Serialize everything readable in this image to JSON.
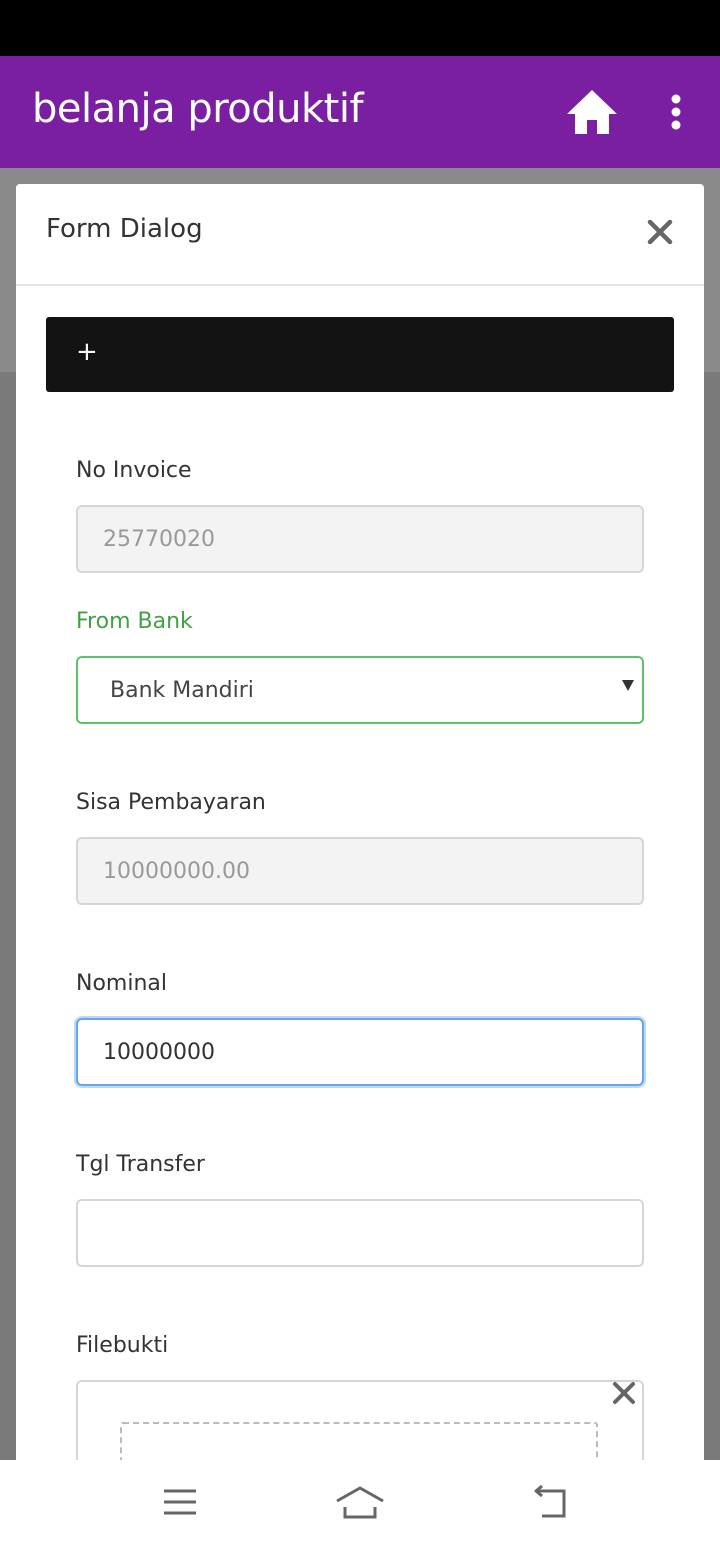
{
  "app": {
    "title": "belanja produktif",
    "accent_color": "#7b1fa2",
    "icons": [
      "home-icon",
      "more-vert-icon"
    ]
  },
  "dialog": {
    "title": "Form Dialog",
    "close_icon": "close-icon",
    "add_bar_label": "+"
  },
  "form": {
    "no_invoice": {
      "label": "No Invoice",
      "value": "25770020"
    },
    "from_bank": {
      "label": "From Bank",
      "selected": "Bank Mandiri"
    },
    "sisa_pembayaran": {
      "label": "Sisa Pembayaran",
      "value": "10000000.00"
    },
    "nominal": {
      "label": "Nominal",
      "value": "10000000"
    },
    "tgl_transfer": {
      "label": "Tgl Transfer",
      "value": ""
    },
    "filebukti": {
      "label": "Filebukti"
    }
  },
  "nav": {
    "icons": [
      "menu-icon",
      "home-outline-icon",
      "back-icon"
    ]
  }
}
